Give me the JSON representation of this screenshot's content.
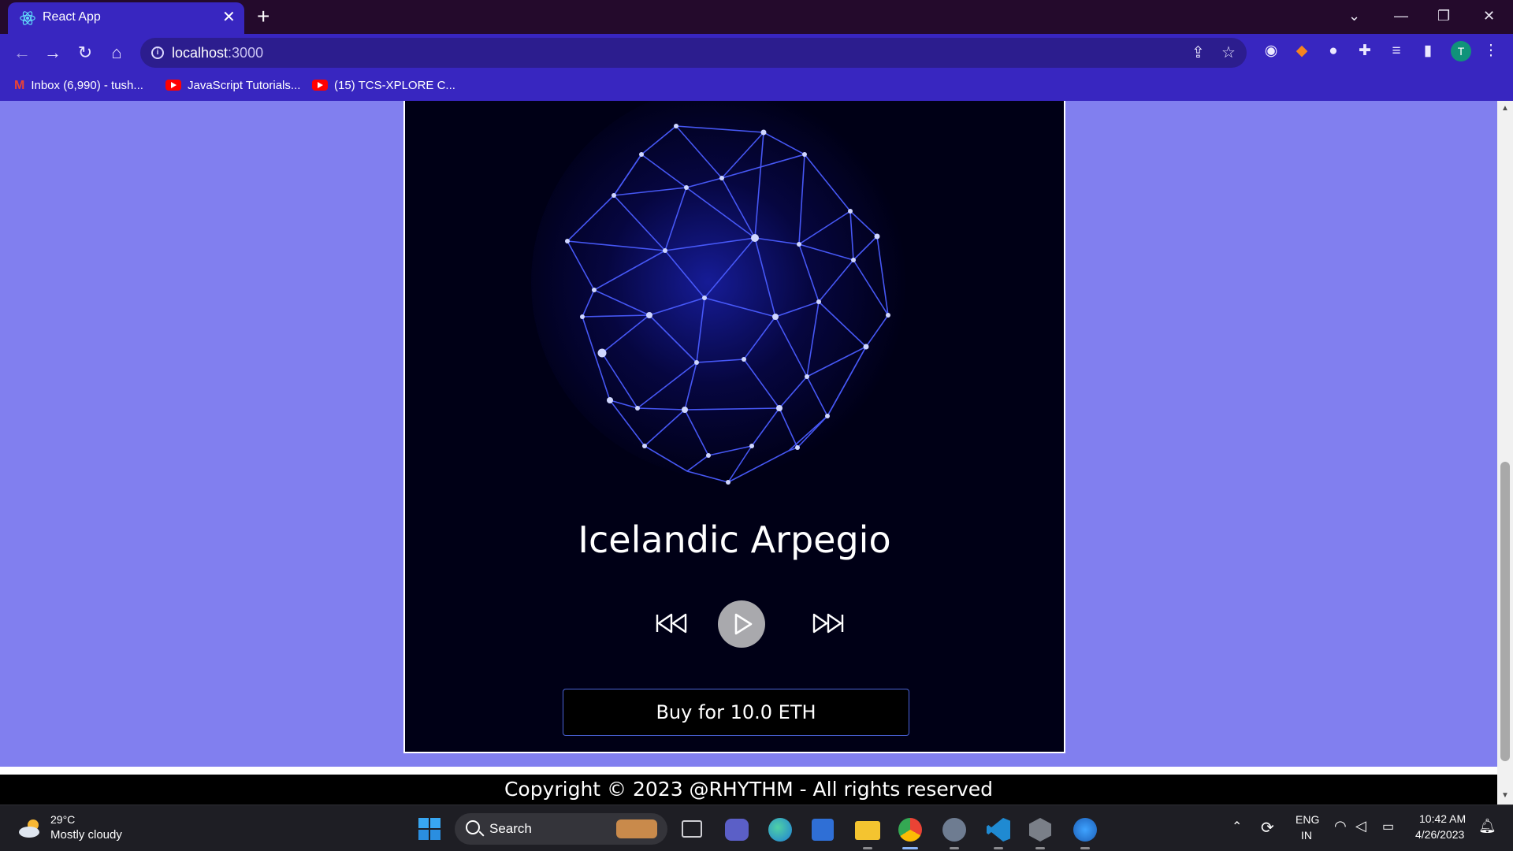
{
  "browser": {
    "tab_title": "React App",
    "url_host": "localhost",
    "url_port": ":3000",
    "bookmarks": [
      {
        "label": "Inbox (6,990) - tush...",
        "icon": "gmail-icon"
      },
      {
        "label": "JavaScript Tutorials...",
        "icon": "youtube-icon"
      },
      {
        "label": "(15) TCS-XPLORE C...",
        "icon": "youtube-icon"
      }
    ],
    "profile_initial": "T"
  },
  "player": {
    "song_title": "Icelandic Arpegio",
    "buy_label": "Buy for 10.0 ETH"
  },
  "footer": {
    "copyright": "Copyright © 2023 @RHYTHM - All rights reserved"
  },
  "taskbar": {
    "weather_temp": "29°C",
    "weather_desc": "Mostly cloudy",
    "search_label": "Search",
    "lang_top": "ENG",
    "lang_bottom": "IN",
    "time": "10:42 AM",
    "date": "4/26/2023"
  },
  "colors": {
    "page_bg": "#817fef",
    "chrome_accent": "#3826c0",
    "card_bg": "#000016",
    "network_line": "#4a5cff"
  }
}
